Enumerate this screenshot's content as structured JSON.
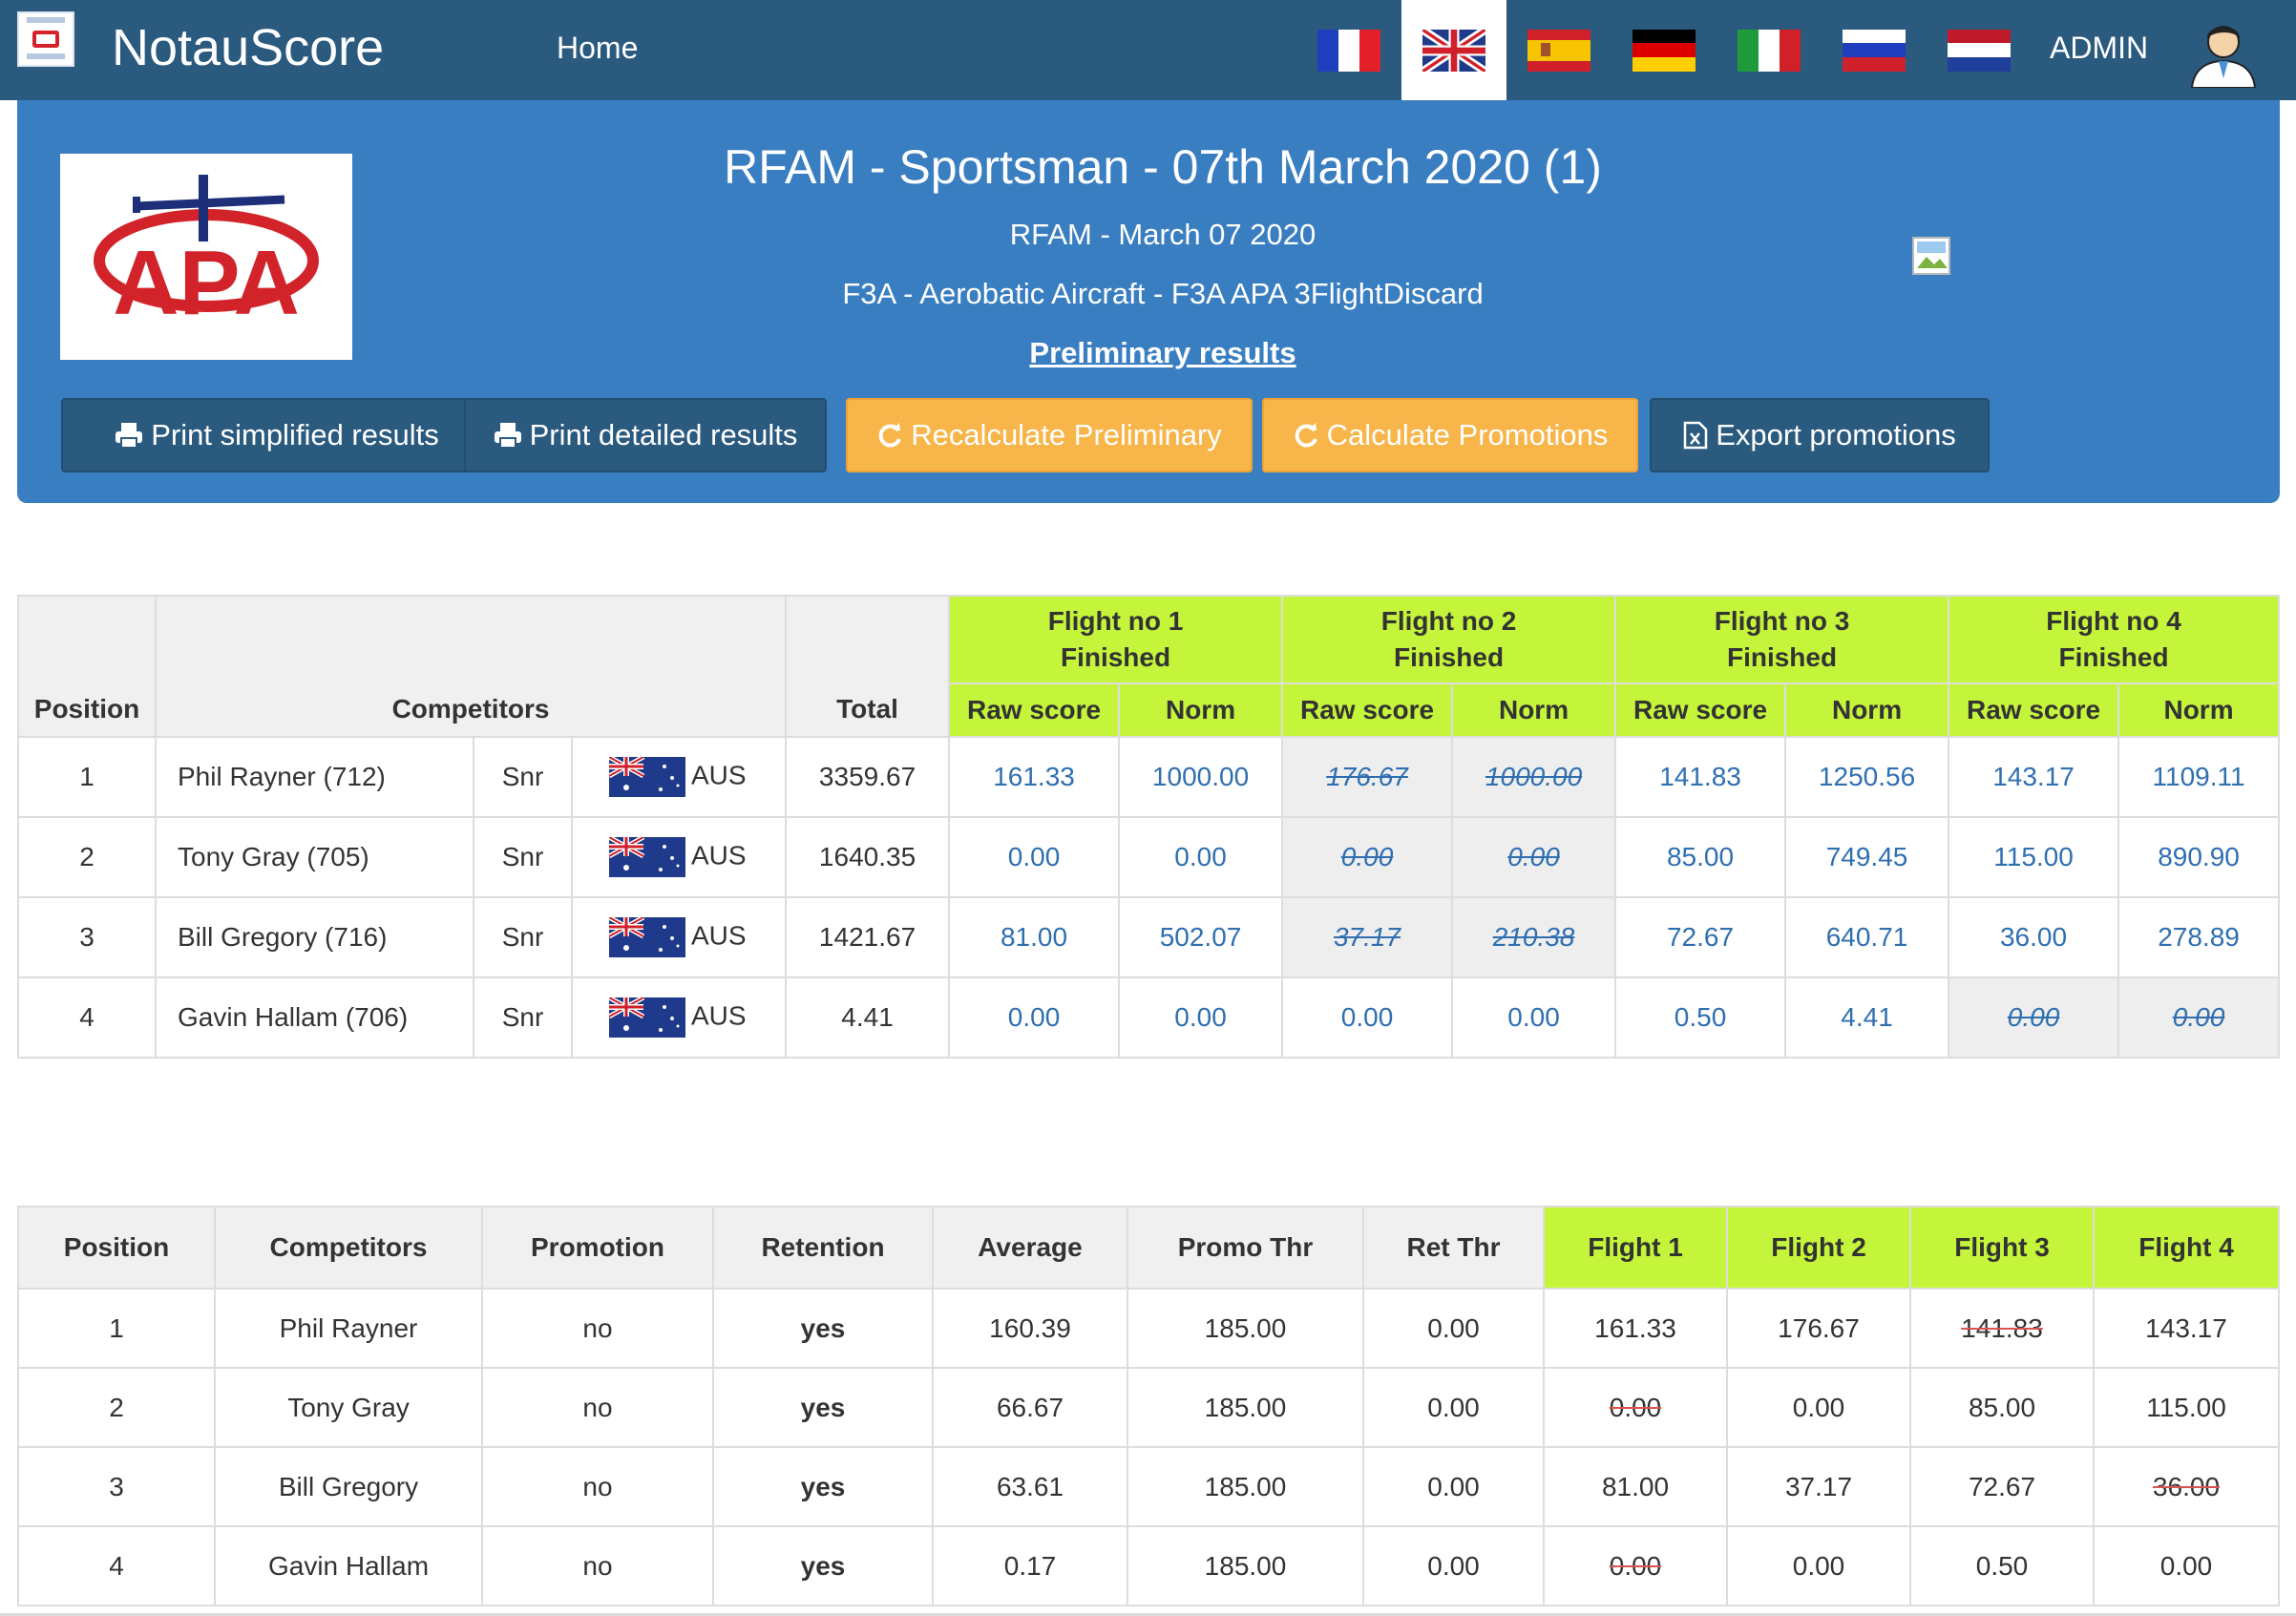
{
  "navbar": {
    "brand": "NotauScore",
    "home_label": "Home",
    "admin_label": "ADMIN",
    "languages": [
      "fr-flag",
      "gb-flag",
      "es-flag",
      "de-flag",
      "it-flag",
      "ru-flag",
      "nl-flag"
    ],
    "active_language": "gb-flag",
    "bg_color": "#2b5a7f"
  },
  "header": {
    "logo_text": "APA",
    "title": "RFAM - Sportsman - 07th March 2020 (1)",
    "subtitle": "RFAM - March 07 2020",
    "category": "F3A - Aerobatic Aircraft - F3A APA 3FlightDiscard",
    "status": "Preliminary results",
    "bg_color": "#3a7ec2",
    "buttons": {
      "print_simplified": "Print simplified results",
      "print_detailed": "Print detailed results",
      "recalculate": "Recalculate Preliminary",
      "calculate_promotions": "Calculate Promotions",
      "export_promotions": "Export promotions"
    }
  },
  "results": {
    "headers": {
      "position": "Position",
      "competitors": "Competitors",
      "total": "Total",
      "raw_score": "Raw score",
      "norm": "Norm"
    },
    "flights": [
      {
        "name": "Flight no 1",
        "status": "Finished"
      },
      {
        "name": "Flight no 2",
        "status": "Finished"
      },
      {
        "name": "Flight no 3",
        "status": "Finished"
      },
      {
        "name": "Flight no 4",
        "status": "Finished"
      }
    ],
    "rows": [
      {
        "position": "1",
        "name": "Phil Rayner (712)",
        "class": "Snr",
        "country": "AUS",
        "total": "3359.67",
        "scores": [
          [
            "161.33",
            "1000.00"
          ],
          [
            "176.67",
            "1000.00"
          ],
          [
            "141.83",
            "1250.56"
          ],
          [
            "143.17",
            "1109.11"
          ]
        ],
        "discarded_flight": 1
      },
      {
        "position": "2",
        "name": "Tony Gray (705)",
        "class": "Snr",
        "country": "AUS",
        "total": "1640.35",
        "scores": [
          [
            "0.00",
            "0.00"
          ],
          [
            "0.00",
            "0.00"
          ],
          [
            "85.00",
            "749.45"
          ],
          [
            "115.00",
            "890.90"
          ]
        ],
        "discarded_flight": 1
      },
      {
        "position": "3",
        "name": "Bill Gregory (716)",
        "class": "Snr",
        "country": "AUS",
        "total": "1421.67",
        "scores": [
          [
            "81.00",
            "502.07"
          ],
          [
            "37.17",
            "210.38"
          ],
          [
            "72.67",
            "640.71"
          ],
          [
            "36.00",
            "278.89"
          ]
        ],
        "discarded_flight": 1
      },
      {
        "position": "4",
        "name": "Gavin Hallam (706)",
        "class": "Snr",
        "country": "AUS",
        "total": "4.41",
        "scores": [
          [
            "0.00",
            "0.00"
          ],
          [
            "0.00",
            "0.00"
          ],
          [
            "0.50",
            "4.41"
          ],
          [
            "0.00",
            "0.00"
          ]
        ],
        "discarded_flight": 3
      }
    ]
  },
  "promotions": {
    "headers": {
      "position": "Position",
      "competitors": "Competitors",
      "promotion": "Promotion",
      "retention": "Retention",
      "average": "Average",
      "promo_thr": "Promo Thr",
      "ret_thr": "Ret Thr",
      "flight1": "Flight 1",
      "flight2": "Flight 2",
      "flight3": "Flight 3",
      "flight4": "Flight 4"
    },
    "rows": [
      {
        "position": "1",
        "name": "Phil Rayner",
        "promotion": "no",
        "retention": "yes",
        "average": "160.39",
        "promo_thr": "185.00",
        "ret_thr": "0.00",
        "flights": [
          "161.33",
          "176.67",
          "141.83",
          "143.17"
        ],
        "struck_flight": 2
      },
      {
        "position": "2",
        "name": "Tony Gray",
        "promotion": "no",
        "retention": "yes",
        "average": "66.67",
        "promo_thr": "185.00",
        "ret_thr": "0.00",
        "flights": [
          "0.00",
          "0.00",
          "85.00",
          "115.00"
        ],
        "struck_flight": 0
      },
      {
        "position": "3",
        "name": "Bill Gregory",
        "promotion": "no",
        "retention": "yes",
        "average": "63.61",
        "promo_thr": "185.00",
        "ret_thr": "0.00",
        "flights": [
          "81.00",
          "37.17",
          "72.67",
          "36.00"
        ],
        "struck_flight": 3
      },
      {
        "position": "4",
        "name": "Gavin Hallam",
        "promotion": "no",
        "retention": "yes",
        "average": "0.17",
        "promo_thr": "185.00",
        "ret_thr": "0.00",
        "flights": [
          "0.00",
          "0.00",
          "0.50",
          "0.00"
        ],
        "struck_flight": 0
      }
    ]
  },
  "colors": {
    "flight_header": "#c5f53a",
    "warning_button": "#f7b54a",
    "score_text": "#2f6fb0",
    "strike_red": "#d9534f"
  }
}
